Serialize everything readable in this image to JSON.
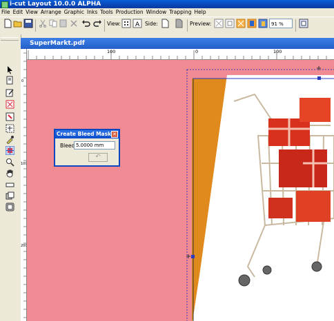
{
  "app": {
    "title": "i-cut Layout 10.0.0 ALPHA"
  },
  "menu": [
    "File",
    "Edit",
    "View",
    "Arrange",
    "Graphic",
    "Inks",
    "Tools",
    "Production",
    "Window",
    "Trapping",
    "Help"
  ],
  "toolbar": {
    "view_label": "View:",
    "side_label": "Side:",
    "preview_label": "Preview:",
    "zoom_value": "91 %"
  },
  "document": {
    "tab_title": "SuperMarkt.pdf"
  },
  "rulers": {
    "h_labels": [
      "100",
      "0",
      "100"
    ],
    "v_labels": [
      "0",
      "100",
      "200"
    ]
  },
  "dialog": {
    "title": "Create Bleed Mask",
    "bleed_label": "Bleed",
    "bleed_value": "5.0000 mm"
  },
  "colors": {
    "canvas": "#f08a93",
    "bleed_orange": "#e08a1e",
    "selection": "#2a3cc0"
  }
}
